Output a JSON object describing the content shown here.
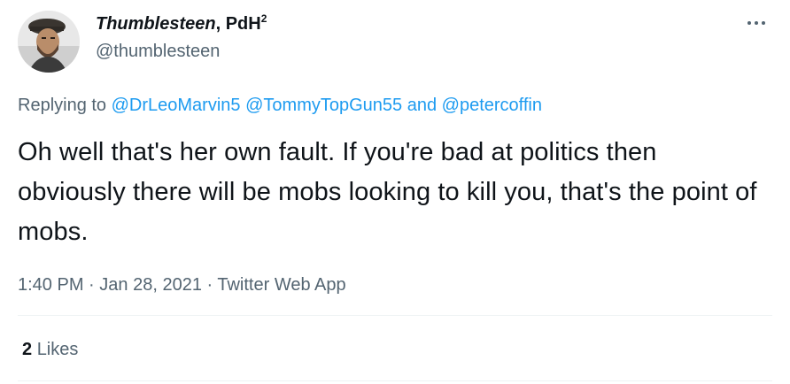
{
  "author": {
    "display_name_italic": "Thumblesteen",
    "display_name_rest": ", PdH",
    "display_name_sup": "2",
    "handle": "@thumblesteen",
    "avatar_icon": "avatar-photo"
  },
  "reply": {
    "prefix": "Replying to",
    "mention_1": "@DrLeoMarvin5",
    "mention_2": "@TommyTopGun55",
    "joiner": "and",
    "mention_3": "@petercoffin"
  },
  "tweet": {
    "text": "Oh well that's her own fault. If you're bad at politics then obviously there will be mobs looking to kill you, that's the point of mobs."
  },
  "meta": {
    "time": "1:40 PM",
    "separator": "·",
    "date": "Jan 28, 2021",
    "source": "Twitter Web App"
  },
  "stats": {
    "likes_count": "2",
    "likes_label": "Likes"
  },
  "icons": {
    "more": "more-horizontal-icon"
  },
  "colors": {
    "link": "#1d9bf0",
    "secondary_text": "#536471",
    "primary_text": "#0f1419",
    "divider": "#eff3f4"
  }
}
